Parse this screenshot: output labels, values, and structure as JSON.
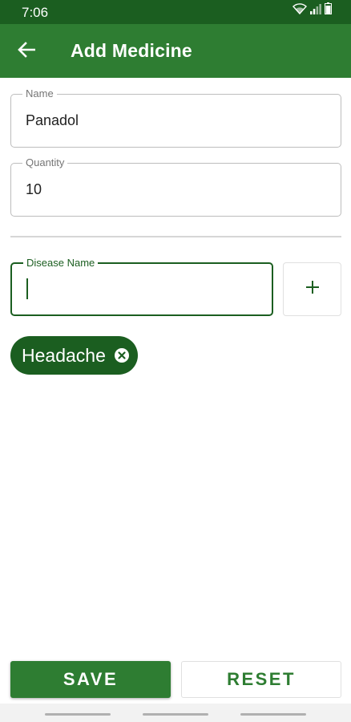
{
  "status_bar": {
    "time": "7:06",
    "icons": [
      "wifi-icon",
      "signal-icon",
      "battery-icon"
    ]
  },
  "app_bar": {
    "title": "Add Medicine",
    "back_icon": "arrow-back-icon"
  },
  "form": {
    "name_field": {
      "label": "Name",
      "value": "Panadol"
    },
    "quantity_field": {
      "label": "Quantity",
      "value": "10"
    },
    "disease_field": {
      "label": "Disease Name",
      "value": ""
    },
    "add_button_icon": "plus-icon"
  },
  "chips": [
    {
      "label": "Headache",
      "delete_icon": "close-circle-icon"
    }
  ],
  "actions": {
    "save_label": "SAVE",
    "reset_label": "RESET"
  },
  "colors": {
    "status_bar": "#1b5e20",
    "app_bar": "#2e7d32",
    "accent": "#1b5e20",
    "chip": "#1b5e20",
    "save_button": "#2e7d32"
  }
}
